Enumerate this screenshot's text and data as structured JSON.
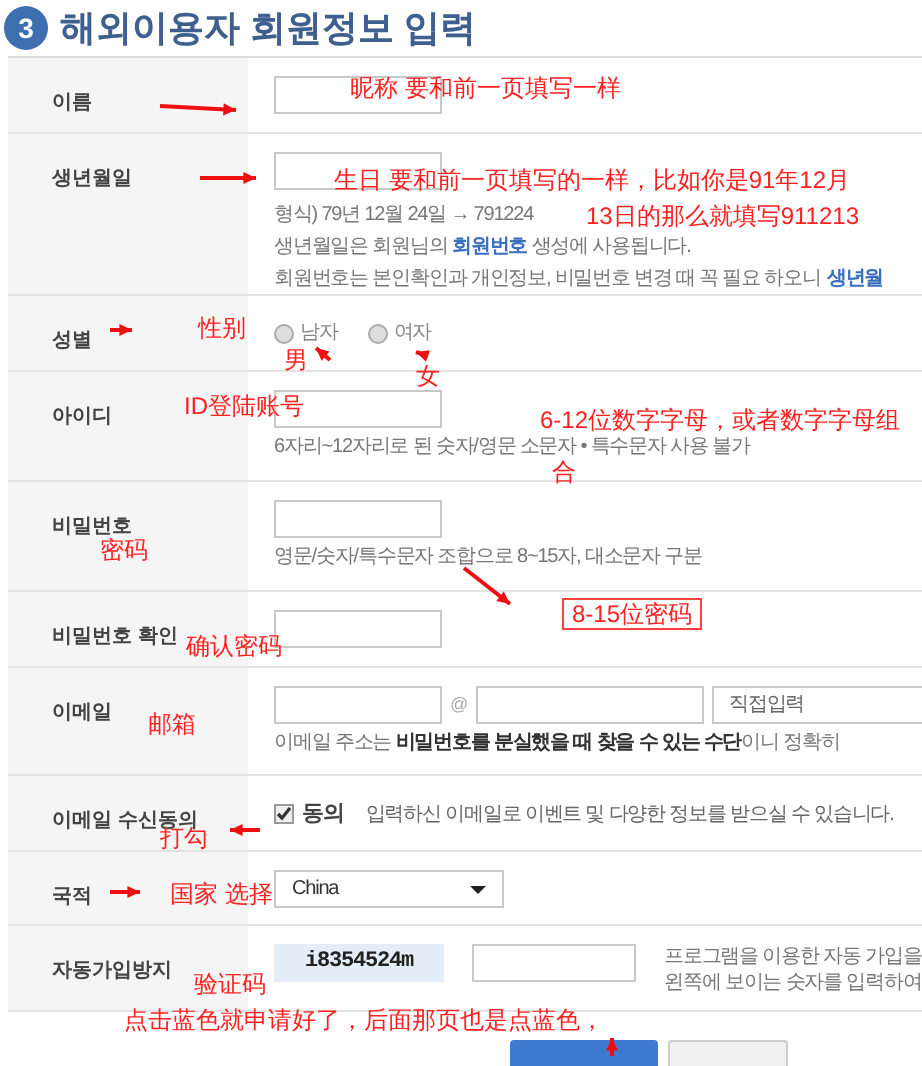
{
  "header": {
    "step": "3",
    "title": "해외이용자 회원정보 입력"
  },
  "rows": [
    {
      "kind": "text",
      "label": "이름"
    },
    {
      "kind": "birth",
      "label": "생년월일",
      "hint": "형식) 79년 12월 24일 → 791224",
      "notes": [
        "생년월일은 회원님의 **회원번호** 생성에 사용됩니다.",
        "회원번호는 본인확인과 개인정보, 비밀번호 변경 때 꼭 필요 하오니"
      ],
      "link": "생년월"
    },
    {
      "kind": "radio",
      "label": "성별",
      "options": [
        {
          "label": "남자",
          "selected": false
        },
        {
          "label": "여자",
          "selected": false
        }
      ]
    },
    {
      "kind": "text",
      "label": "아이디",
      "hint": "6자리~12자리로 된 숫자/영문 소문자 • 특수문자 사용 불가"
    },
    {
      "kind": "text",
      "label": "비밀번호",
      "hint": "영문/숫자/특수문자 조합으로 8~15자, 대소문자 구분"
    },
    {
      "kind": "text",
      "label": "비밀번호 확인"
    },
    {
      "kind": "email",
      "label": "이메일",
      "at": "@",
      "domain": "직접입력",
      "hint": "이메일 주소는 **비밀번호를 분실했을 때 찾을 수 있는 수단**이니 정확히"
    },
    {
      "kind": "check",
      "label": "이메일 수신동의",
      "check_label": "동의",
      "checked": true,
      "text": "입력하신 이메일로 이벤트 및 다양한 정보를 받으실 수 있습니다."
    },
    {
      "kind": "select",
      "label": "국적",
      "value": "China"
    },
    {
      "kind": "captcha",
      "label": "자동가입방지",
      "code": "i8354524m",
      "help": [
        "프로그램을 이용한 자동 가입을",
        "왼쪽에 보이는 숫자를 입력하여"
      ]
    }
  ],
  "annotations": [
    {
      "text": "昵称   要和前一页填写一样"
    },
    {
      "text": "生日  要和前一页填写的一样，比如你是91年12月"
    },
    {
      "text": "13日的那么就填写911213"
    },
    {
      "text": "性别"
    },
    {
      "text": "男"
    },
    {
      "text": "女"
    },
    {
      "text": "ID登陆账号"
    },
    {
      "text": "6-12位数字字母，或者数字字母组"
    },
    {
      "text": "合"
    },
    {
      "text": "密码"
    },
    {
      "text": "8-15位密码",
      "boxed": true
    },
    {
      "text": "确认密码"
    },
    {
      "text": "邮箱"
    },
    {
      "text": "打勾"
    },
    {
      "text": "国家 选择"
    },
    {
      "text": "验证码"
    },
    {
      "text": "点击蓝色就申请好了，后面那页也是点蓝色，"
    }
  ]
}
